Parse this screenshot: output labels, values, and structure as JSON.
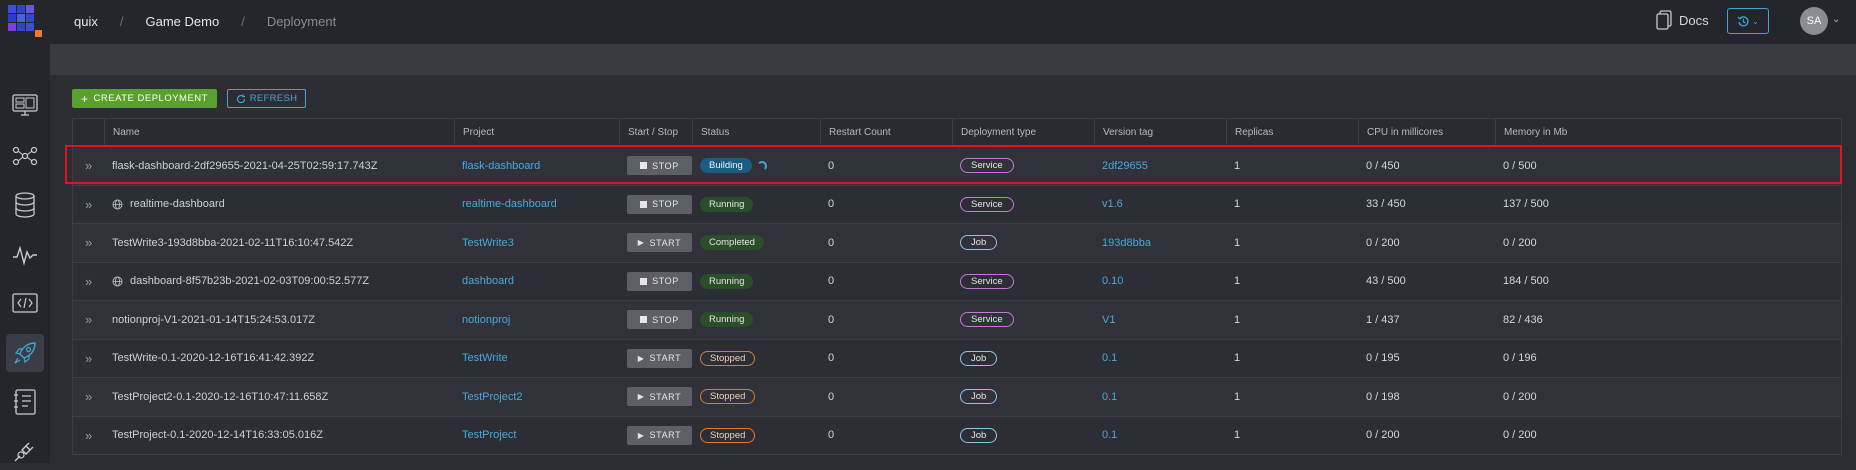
{
  "breadcrumb": [
    "quix",
    "Game Demo",
    "Deployment"
  ],
  "header": {
    "docs_label": "Docs",
    "avatar_initials": "SA"
  },
  "sidebar": {
    "items": [
      {
        "icon": "monitor-icon"
      },
      {
        "icon": "topology-icon"
      },
      {
        "icon": "database-icon"
      },
      {
        "icon": "waveform-icon"
      },
      {
        "icon": "code-icon"
      },
      {
        "icon": "rocket-icon",
        "active": true
      },
      {
        "icon": "notebook-icon"
      },
      {
        "icon": "plug-icon"
      }
    ]
  },
  "toolbar": {
    "create_label": "CREATE DEPLOYMENT",
    "refresh_label": "REFRESH"
  },
  "table": {
    "columns": [
      "Name",
      "Project",
      "Start / Stop",
      "Status",
      "Restart Count",
      "Deployment type",
      "Version tag",
      "Replicas",
      "CPU in millicores",
      "Memory in Mb"
    ],
    "rows": [
      {
        "name": "flask-dashboard-2df29655-2021-04-25T02:59:17.743Z",
        "globe": false,
        "project": "flask-dashboard",
        "action": "STOP",
        "status": "Building",
        "restarts": "0",
        "type": "Service",
        "version": "2df29655",
        "replicas": "1",
        "cpu": "0 / 450",
        "memory": "0 / 500"
      },
      {
        "name": "realtime-dashboard",
        "globe": true,
        "project": "realtime-dashboard",
        "action": "STOP",
        "status": "Running",
        "restarts": "0",
        "type": "Service",
        "version": "v1.6",
        "replicas": "1",
        "cpu": "33 / 450",
        "memory": "137 / 500"
      },
      {
        "name": "TestWrite3-193d8bba-2021-02-11T16:10:47.542Z",
        "globe": false,
        "project": "TestWrite3",
        "action": "START",
        "status": "Completed",
        "restarts": "0",
        "type": "Job",
        "version": "193d8bba",
        "replicas": "1",
        "cpu": "0 / 200",
        "memory": "0 / 200"
      },
      {
        "name": "dashboard-8f57b23b-2021-02-03T09:00:52.577Z",
        "globe": true,
        "project": "dashboard",
        "action": "STOP",
        "status": "Running",
        "restarts": "0",
        "type": "Service",
        "version": "0.10",
        "replicas": "1",
        "cpu": "43 / 500",
        "memory": "184 / 500"
      },
      {
        "name": "notionproj-V1-2021-01-14T15:24:53.017Z",
        "globe": false,
        "project": "notionproj",
        "action": "STOP",
        "status": "Running",
        "restarts": "0",
        "type": "Service",
        "version": "V1",
        "replicas": "1",
        "cpu": "1 / 437",
        "memory": "82 / 436"
      },
      {
        "name": "TestWrite-0.1-2020-12-16T16:41:42.392Z",
        "globe": false,
        "project": "TestWrite",
        "action": "START",
        "status": "Stopped",
        "restarts": "0",
        "type": "Job",
        "version": "0.1",
        "replicas": "1",
        "cpu": "0 / 195",
        "memory": "0 / 196"
      },
      {
        "name": "TestProject2-0.1-2020-12-16T10:47:11.658Z",
        "globe": false,
        "project": "TestProject2",
        "action": "START",
        "status": "Stopped",
        "restarts": "0",
        "type": "Job",
        "version": "0.1",
        "replicas": "1",
        "cpu": "0 / 198",
        "memory": "0 / 200"
      },
      {
        "name": "TestProject-0.1-2020-12-14T16:33:05.016Z",
        "globe": false,
        "project": "TestProject",
        "action": "START",
        "status": "Stopped",
        "restarts": "0",
        "type": "Job",
        "version": "0.1",
        "replicas": "1",
        "cpu": "0 / 200",
        "memory": "0 / 200"
      }
    ]
  },
  "colors": {
    "accent": "#3ea7d6",
    "create": "#5aa02c",
    "highlight": "#e0141a",
    "service": "#c679d8",
    "job": "#8fc6e8",
    "stopped": "#e07b2a"
  }
}
